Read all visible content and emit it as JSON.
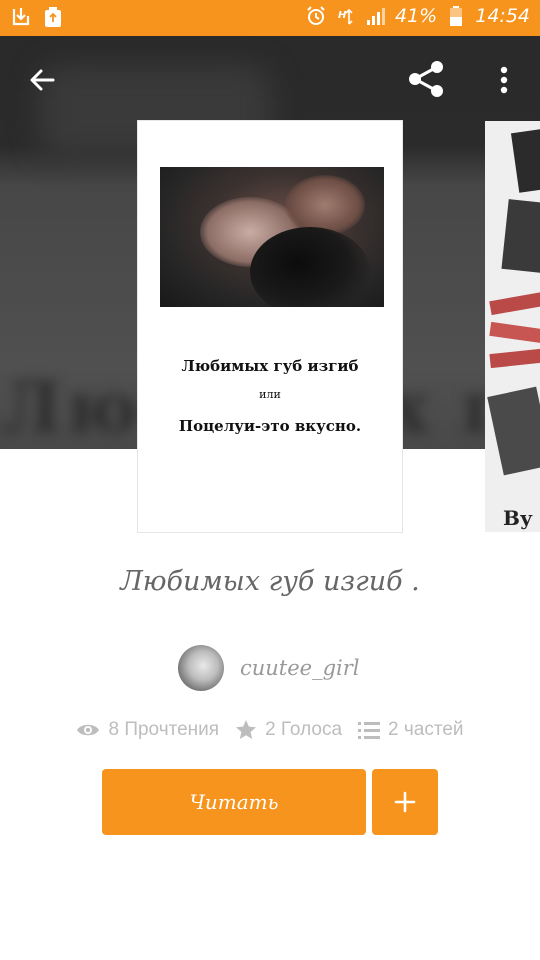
{
  "status_bar": {
    "battery_percent": "41%",
    "time": "14:54",
    "icons": [
      "download-icon",
      "recycle-icon",
      "alarm-icon",
      "data-h-icon",
      "signal-icon",
      "battery-icon"
    ],
    "background": "#f7941d"
  },
  "top_bar": {
    "back_icon": "arrow-left-icon",
    "share_icon": "share-icon",
    "menu_icon": "more-vertical-icon"
  },
  "cover": {
    "line1": "Любимых губ изгиб",
    "line2": "или",
    "line3": "Поцелуи-это вкусно."
  },
  "next_cover": {
    "fragment": "Ву"
  },
  "story": {
    "title": "Любимых губ изгиб .",
    "author": "cuutee_girl"
  },
  "stats": {
    "reads": "8 Прочтения",
    "votes": "2 Голоса",
    "parts": "2 частей"
  },
  "actions": {
    "read_label": "Читать",
    "add_label": "+",
    "accent": "#f7941d"
  }
}
